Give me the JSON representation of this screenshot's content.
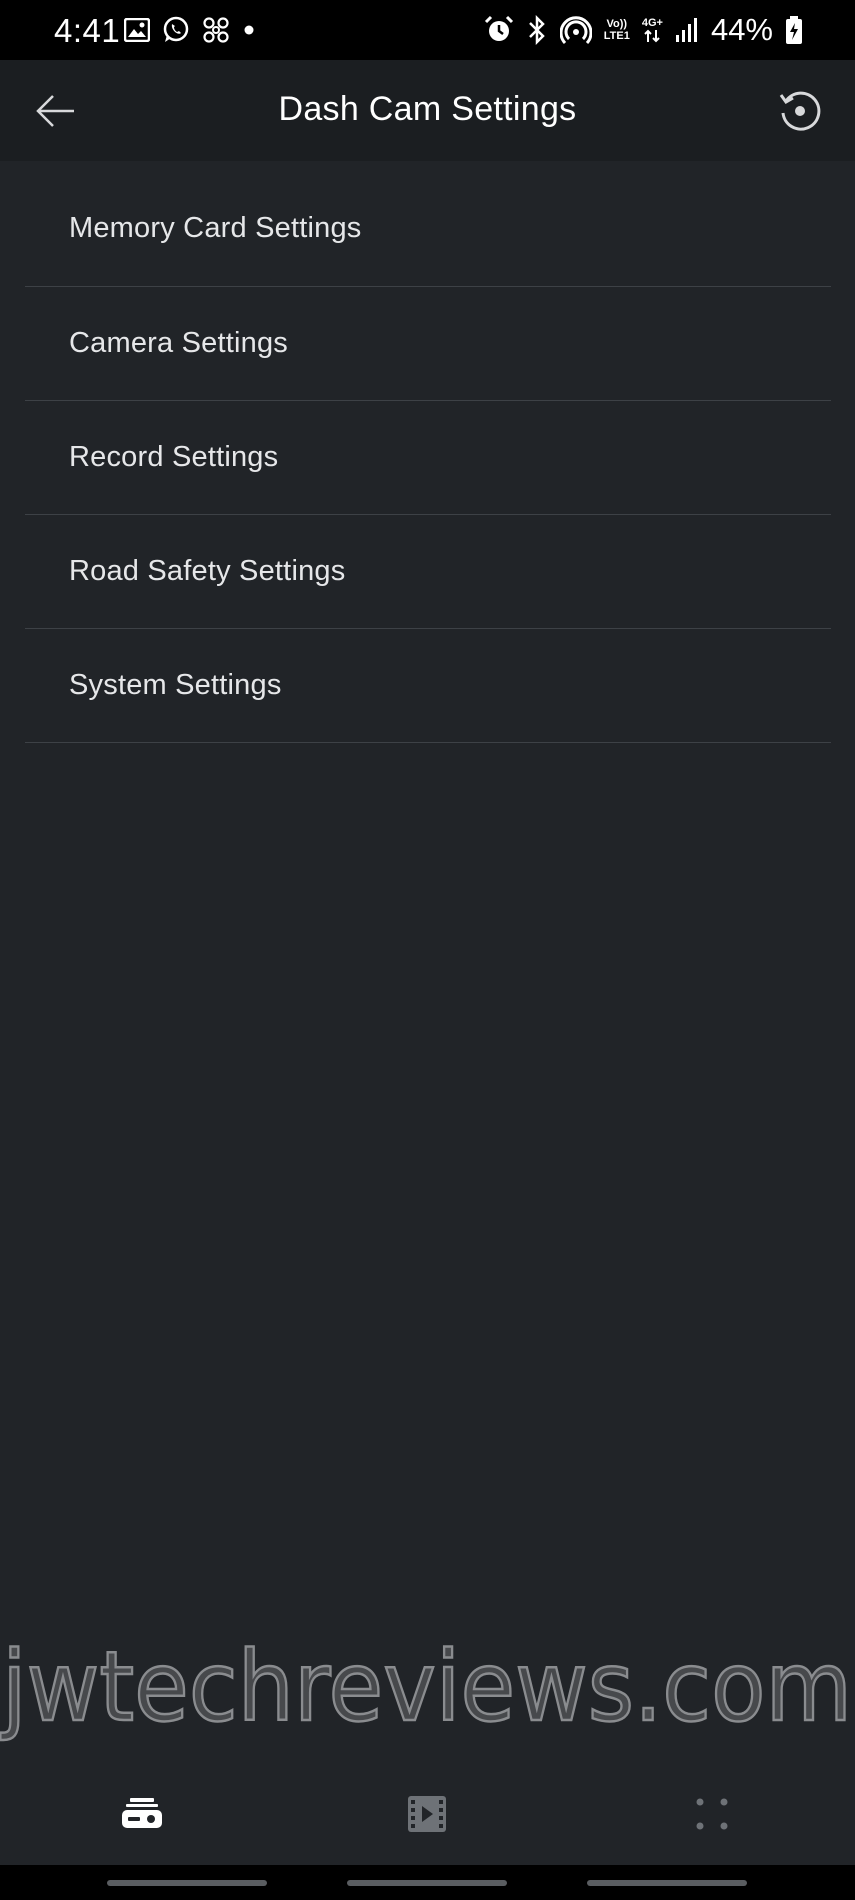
{
  "status_bar": {
    "time": "4:41",
    "battery": "44%",
    "network_top": "Vo))",
    "network_bottom": "LTE1",
    "data_type": "4G+"
  },
  "app_bar": {
    "title": "Dash Cam Settings"
  },
  "settings": {
    "items": [
      {
        "label": "Memory Card Settings"
      },
      {
        "label": "Camera Settings"
      },
      {
        "label": "Record Settings"
      },
      {
        "label": "Road Safety Settings"
      },
      {
        "label": "System Settings"
      }
    ]
  },
  "watermark": {
    "text": "jwtechreviews.com"
  },
  "bottom_nav": {
    "items": [
      {
        "icon": "dashcam-icon",
        "active": true
      },
      {
        "icon": "video-film-icon",
        "active": false
      },
      {
        "icon": "more-dots-icon",
        "active": false
      }
    ]
  },
  "colors": {
    "background": "#212428",
    "app_bar": "#1b1e21",
    "divider": "#3d4146",
    "text": "#e6e7e9",
    "active_icon": "#ffffff",
    "inactive_icon": "#6e7277"
  }
}
